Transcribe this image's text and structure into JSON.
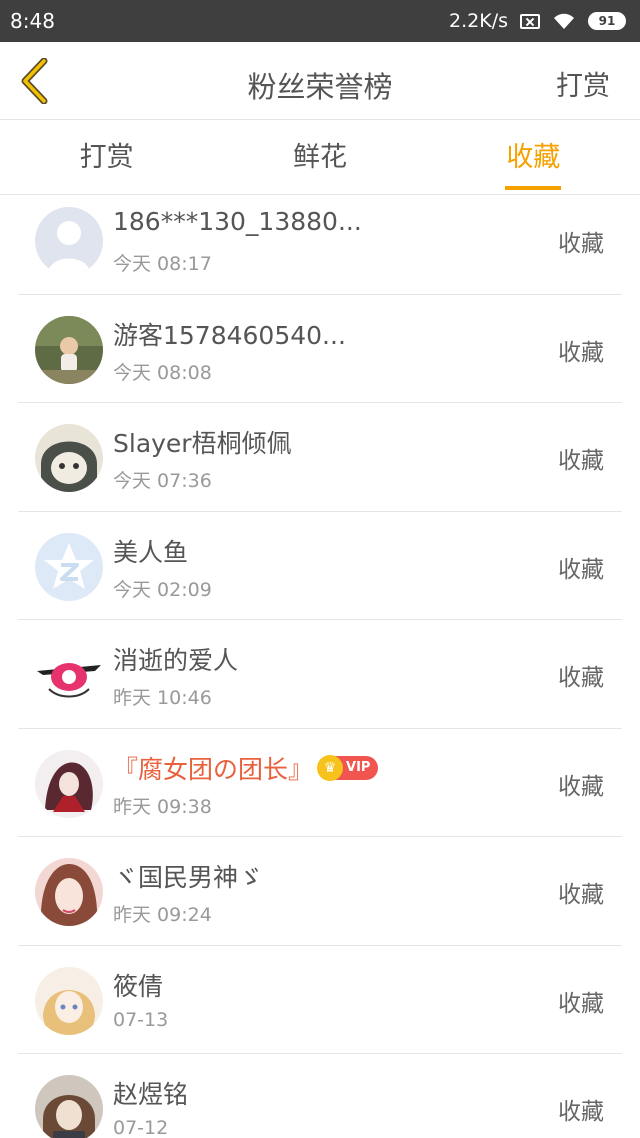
{
  "status_bar": {
    "time": "8:48",
    "network_speed": "2.2K/s",
    "battery": "91"
  },
  "header": {
    "title": "粉丝荣誉榜",
    "action_label": "打赏"
  },
  "tabs": [
    {
      "label": "打赏",
      "active": false
    },
    {
      "label": "鲜花",
      "active": false
    },
    {
      "label": "收藏",
      "active": true
    }
  ],
  "fans": [
    {
      "name": "186***130_13880...",
      "time": "今天 08:17",
      "action": "收藏",
      "vip": false,
      "avatar": "default-avatar"
    },
    {
      "name": "游客1578460540...",
      "time": "今天 08:08",
      "action": "收藏",
      "vip": false,
      "avatar": "photo-avatar"
    },
    {
      "name": "Slayer梧桐倾佩",
      "time": "今天 07:36",
      "action": "收藏",
      "vip": false,
      "avatar": "anime-avatar"
    },
    {
      "name": "美人鱼",
      "time": "今天 02:09",
      "action": "收藏",
      "vip": false,
      "avatar": "qzone-avatar"
    },
    {
      "name": "消逝的爱人",
      "time": "昨天 10:46",
      "action": "收藏",
      "vip": false,
      "avatar": "eye-avatar"
    },
    {
      "name": "『腐女团の团长』",
      "time": "昨天 09:38",
      "action": "收藏",
      "vip": true,
      "vip_label": "VIP",
      "avatar": "anime-avatar"
    },
    {
      "name": "ヾ国民男神ゞ",
      "time": "昨天 09:24",
      "action": "收藏",
      "vip": false,
      "avatar": "photo-avatar"
    },
    {
      "name": "筱倩",
      "time": "07-13",
      "action": "收藏",
      "vip": false,
      "avatar": "anime-avatar"
    },
    {
      "name": "赵煜铭",
      "time": "07-12",
      "action": "收藏",
      "vip": false,
      "avatar": "anime-avatar"
    }
  ],
  "colors": {
    "accent": "#f5a100",
    "vip_name": "#e8603c",
    "status_bar": "#3f3f3f"
  }
}
